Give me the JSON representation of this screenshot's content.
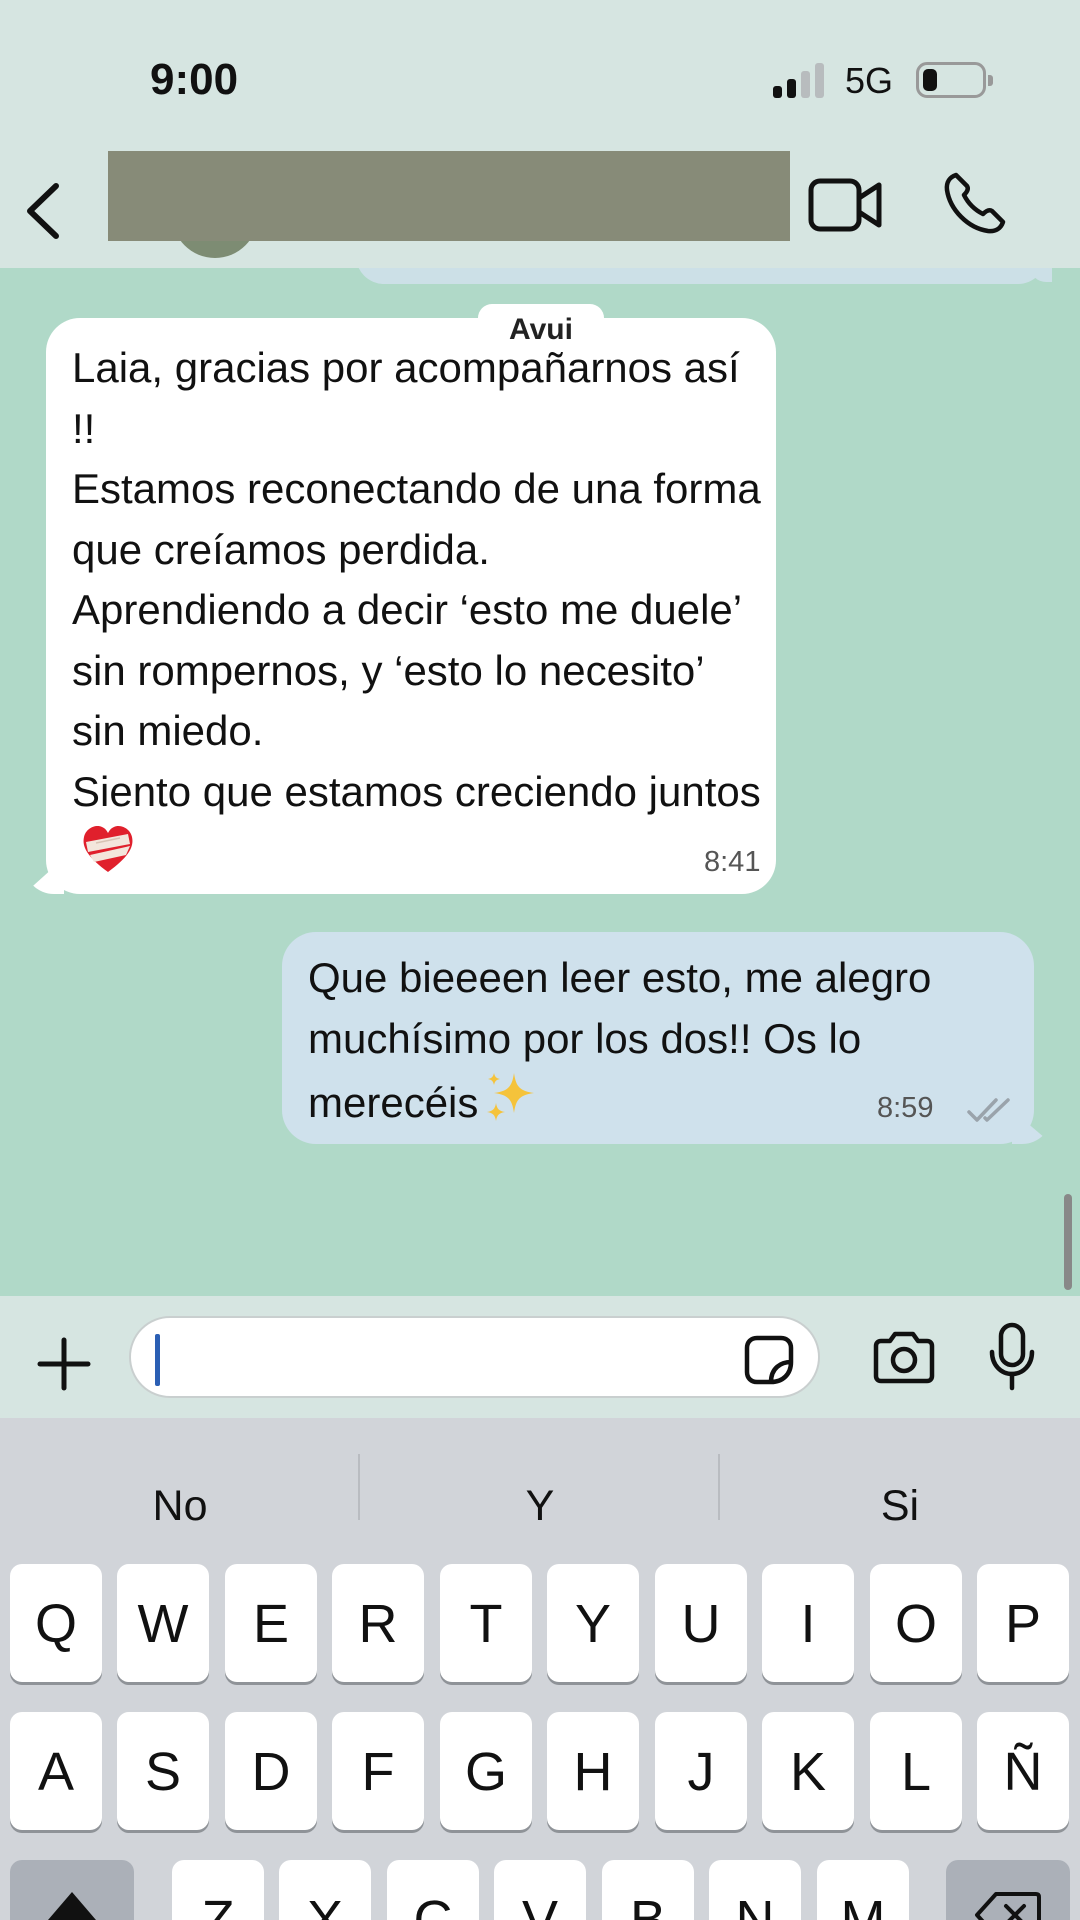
{
  "status_bar": {
    "time": "9:00",
    "network": "5G"
  },
  "header": {
    "contact_name": ""
  },
  "chat": {
    "day_label": "Avui",
    "messages": [
      {
        "direction": "incoming",
        "text": "Laia, gracias por acompañarnos así !!\nEstamos reconectando de una forma que creíamos perdida.\nAprendiendo a decir ‘esto me duele’ sin rompernos, y ‘esto lo necesito’ sin miedo.\nSiento que estamos creciendo juntos",
        "emoji": "mending-heart",
        "time": "8:41"
      },
      {
        "direction": "outgoing",
        "text": "Que bieeeen leer esto, me alegro muchísimo por los dos!! Os lo merecéis",
        "emoji": "sparkles",
        "time": "8:59",
        "status": "read"
      }
    ]
  },
  "composer": {
    "value": "",
    "placeholder": ""
  },
  "keyboard": {
    "suggestions": [
      "No",
      "Y",
      "Si"
    ],
    "rows": [
      [
        "Q",
        "W",
        "E",
        "R",
        "T",
        "Y",
        "U",
        "I",
        "O",
        "P"
      ],
      [
        "A",
        "S",
        "D",
        "F",
        "G",
        "H",
        "J",
        "K",
        "L",
        "Ñ"
      ],
      [
        "Z",
        "X",
        "C",
        "V",
        "B",
        "N",
        "M"
      ]
    ]
  },
  "colors": {
    "chat_background": "#b0d9c8",
    "incoming_bubble": "#ffffff",
    "outgoing_bubble": "#cfe1ec",
    "header_background": "#d6e5e1",
    "keyboard_background": "#d1d4d9"
  }
}
